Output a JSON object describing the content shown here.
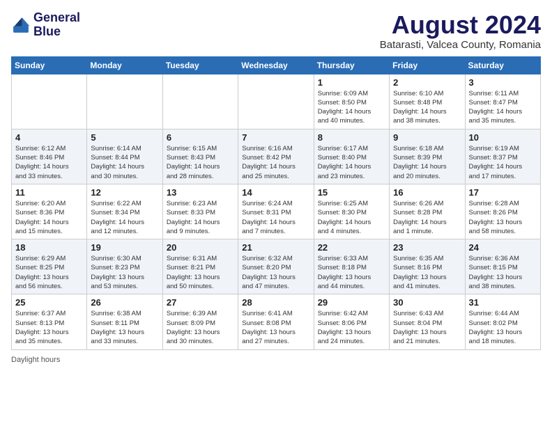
{
  "header": {
    "logo_line1": "General",
    "logo_line2": "Blue",
    "month_year": "August 2024",
    "location": "Batarasti, Valcea County, Romania"
  },
  "days_of_week": [
    "Sunday",
    "Monday",
    "Tuesday",
    "Wednesday",
    "Thursday",
    "Friday",
    "Saturday"
  ],
  "weeks": [
    [
      {
        "day": "",
        "info": ""
      },
      {
        "day": "",
        "info": ""
      },
      {
        "day": "",
        "info": ""
      },
      {
        "day": "",
        "info": ""
      },
      {
        "day": "1",
        "info": "Sunrise: 6:09 AM\nSunset: 8:50 PM\nDaylight: 14 hours\nand 40 minutes."
      },
      {
        "day": "2",
        "info": "Sunrise: 6:10 AM\nSunset: 8:48 PM\nDaylight: 14 hours\nand 38 minutes."
      },
      {
        "day": "3",
        "info": "Sunrise: 6:11 AM\nSunset: 8:47 PM\nDaylight: 14 hours\nand 35 minutes."
      }
    ],
    [
      {
        "day": "4",
        "info": "Sunrise: 6:12 AM\nSunset: 8:46 PM\nDaylight: 14 hours\nand 33 minutes."
      },
      {
        "day": "5",
        "info": "Sunrise: 6:14 AM\nSunset: 8:44 PM\nDaylight: 14 hours\nand 30 minutes."
      },
      {
        "day": "6",
        "info": "Sunrise: 6:15 AM\nSunset: 8:43 PM\nDaylight: 14 hours\nand 28 minutes."
      },
      {
        "day": "7",
        "info": "Sunrise: 6:16 AM\nSunset: 8:42 PM\nDaylight: 14 hours\nand 25 minutes."
      },
      {
        "day": "8",
        "info": "Sunrise: 6:17 AM\nSunset: 8:40 PM\nDaylight: 14 hours\nand 23 minutes."
      },
      {
        "day": "9",
        "info": "Sunrise: 6:18 AM\nSunset: 8:39 PM\nDaylight: 14 hours\nand 20 minutes."
      },
      {
        "day": "10",
        "info": "Sunrise: 6:19 AM\nSunset: 8:37 PM\nDaylight: 14 hours\nand 17 minutes."
      }
    ],
    [
      {
        "day": "11",
        "info": "Sunrise: 6:20 AM\nSunset: 8:36 PM\nDaylight: 14 hours\nand 15 minutes."
      },
      {
        "day": "12",
        "info": "Sunrise: 6:22 AM\nSunset: 8:34 PM\nDaylight: 14 hours\nand 12 minutes."
      },
      {
        "day": "13",
        "info": "Sunrise: 6:23 AM\nSunset: 8:33 PM\nDaylight: 14 hours\nand 9 minutes."
      },
      {
        "day": "14",
        "info": "Sunrise: 6:24 AM\nSunset: 8:31 PM\nDaylight: 14 hours\nand 7 minutes."
      },
      {
        "day": "15",
        "info": "Sunrise: 6:25 AM\nSunset: 8:30 PM\nDaylight: 14 hours\nand 4 minutes."
      },
      {
        "day": "16",
        "info": "Sunrise: 6:26 AM\nSunset: 8:28 PM\nDaylight: 14 hours\nand 1 minute."
      },
      {
        "day": "17",
        "info": "Sunrise: 6:28 AM\nSunset: 8:26 PM\nDaylight: 13 hours\nand 58 minutes."
      }
    ],
    [
      {
        "day": "18",
        "info": "Sunrise: 6:29 AM\nSunset: 8:25 PM\nDaylight: 13 hours\nand 56 minutes."
      },
      {
        "day": "19",
        "info": "Sunrise: 6:30 AM\nSunset: 8:23 PM\nDaylight: 13 hours\nand 53 minutes."
      },
      {
        "day": "20",
        "info": "Sunrise: 6:31 AM\nSunset: 8:21 PM\nDaylight: 13 hours\nand 50 minutes."
      },
      {
        "day": "21",
        "info": "Sunrise: 6:32 AM\nSunset: 8:20 PM\nDaylight: 13 hours\nand 47 minutes."
      },
      {
        "day": "22",
        "info": "Sunrise: 6:33 AM\nSunset: 8:18 PM\nDaylight: 13 hours\nand 44 minutes."
      },
      {
        "day": "23",
        "info": "Sunrise: 6:35 AM\nSunset: 8:16 PM\nDaylight: 13 hours\nand 41 minutes."
      },
      {
        "day": "24",
        "info": "Sunrise: 6:36 AM\nSunset: 8:15 PM\nDaylight: 13 hours\nand 38 minutes."
      }
    ],
    [
      {
        "day": "25",
        "info": "Sunrise: 6:37 AM\nSunset: 8:13 PM\nDaylight: 13 hours\nand 35 minutes."
      },
      {
        "day": "26",
        "info": "Sunrise: 6:38 AM\nSunset: 8:11 PM\nDaylight: 13 hours\nand 33 minutes."
      },
      {
        "day": "27",
        "info": "Sunrise: 6:39 AM\nSunset: 8:09 PM\nDaylight: 13 hours\nand 30 minutes."
      },
      {
        "day": "28",
        "info": "Sunrise: 6:41 AM\nSunset: 8:08 PM\nDaylight: 13 hours\nand 27 minutes."
      },
      {
        "day": "29",
        "info": "Sunrise: 6:42 AM\nSunset: 8:06 PM\nDaylight: 13 hours\nand 24 minutes."
      },
      {
        "day": "30",
        "info": "Sunrise: 6:43 AM\nSunset: 8:04 PM\nDaylight: 13 hours\nand 21 minutes."
      },
      {
        "day": "31",
        "info": "Sunrise: 6:44 AM\nSunset: 8:02 PM\nDaylight: 13 hours\nand 18 minutes."
      }
    ]
  ],
  "footer": {
    "daylight_label": "Daylight hours"
  }
}
